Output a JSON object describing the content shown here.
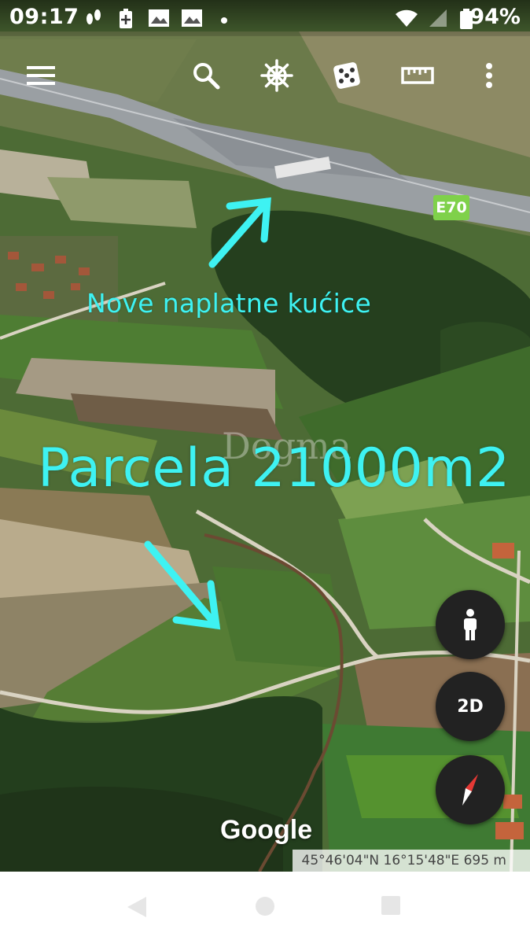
{
  "status_bar": {
    "time": "09:17",
    "battery_percent": "94%",
    "left_icons": [
      "footprints-icon",
      "battery-plus-icon",
      "gallery-icon",
      "gallery-icon",
      "dot-icon"
    ],
    "right_icons": [
      "wifi-icon",
      "signal-icon",
      "battery-icon"
    ]
  },
  "toolbar": {
    "icons": [
      "menu-icon",
      "search-icon",
      "ship-wheel-icon",
      "dice-icon",
      "ruler-icon",
      "more-icon"
    ]
  },
  "map": {
    "annotation_toll": "Nove naplatne kućice",
    "annotation_parcel": "Parcela 21000m2",
    "watermark": "Dogma",
    "road_label": "E70",
    "attribution": "Google",
    "coordinates": "45°46'04\"N 16°15'48\"E 695 m"
  },
  "map_buttons": {
    "street_view_icon": "person-icon",
    "view_mode": "2D",
    "compass_icon": "compass-icon"
  },
  "nav_bar": {
    "icons": [
      "back-icon",
      "home-icon",
      "recents-icon"
    ]
  },
  "colors": {
    "annotation": "#3ef2f2",
    "road_shield": "#7fd14a",
    "button_bg": "#222222"
  }
}
